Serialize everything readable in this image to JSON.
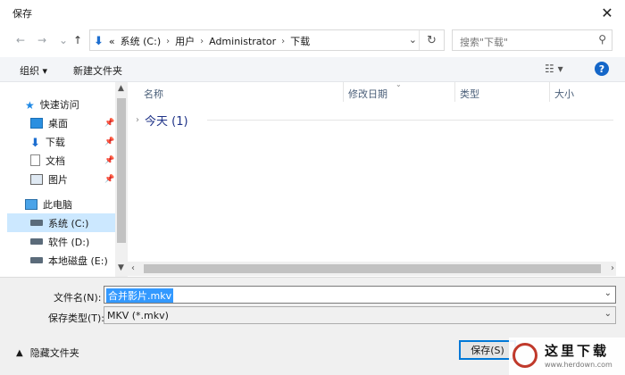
{
  "window": {
    "title": "保存",
    "close_glyph": "✕"
  },
  "nav": {
    "back": "←",
    "forward": "→",
    "recent": "⌄",
    "up": "↑"
  },
  "address": {
    "overflow": "«",
    "crumbs": [
      "系统 (C:)",
      "用户",
      "Administrator",
      "下载"
    ],
    "separator": "›"
  },
  "search": {
    "placeholder": "搜索\"下载\""
  },
  "toolbar": {
    "organize": "组织 ▾",
    "new_folder": "新建文件夹",
    "help": "?"
  },
  "sidebar": {
    "items": [
      {
        "label": "快速访问",
        "icon": "star-icon"
      },
      {
        "label": "桌面",
        "icon": "desktop-icon"
      },
      {
        "label": "下载",
        "icon": "download-icon"
      },
      {
        "label": "文档",
        "icon": "document-icon"
      },
      {
        "label": "图片",
        "icon": "pictures-icon"
      },
      {
        "label": "此电脑",
        "icon": "computer-icon"
      },
      {
        "label": "系统 (C:)",
        "icon": "drive-icon"
      },
      {
        "label": "软件 (D:)",
        "icon": "drive-icon"
      },
      {
        "label": "本地磁盘 (E:)",
        "icon": "drive-icon"
      }
    ]
  },
  "columns": {
    "name": "名称",
    "date": "修改日期",
    "type": "类型",
    "size": "大小"
  },
  "groups": [
    {
      "label": "今天 (1)"
    }
  ],
  "form": {
    "filename_label": "文件名(N):",
    "filename_value": "合并影片.mkv",
    "filetype_label": "保存类型(T):",
    "filetype_value": "MKV (*.mkv)"
  },
  "footer": {
    "hide_folders": "隐藏文件夹",
    "save": "保存(S)"
  },
  "watermark": {
    "text": "这里下载",
    "url": "www.herdown.com"
  },
  "colors": {
    "accent": "#0078d7",
    "selection": "#cce8ff",
    "highlight": "#3399ff",
    "group_text": "#1e3287"
  }
}
